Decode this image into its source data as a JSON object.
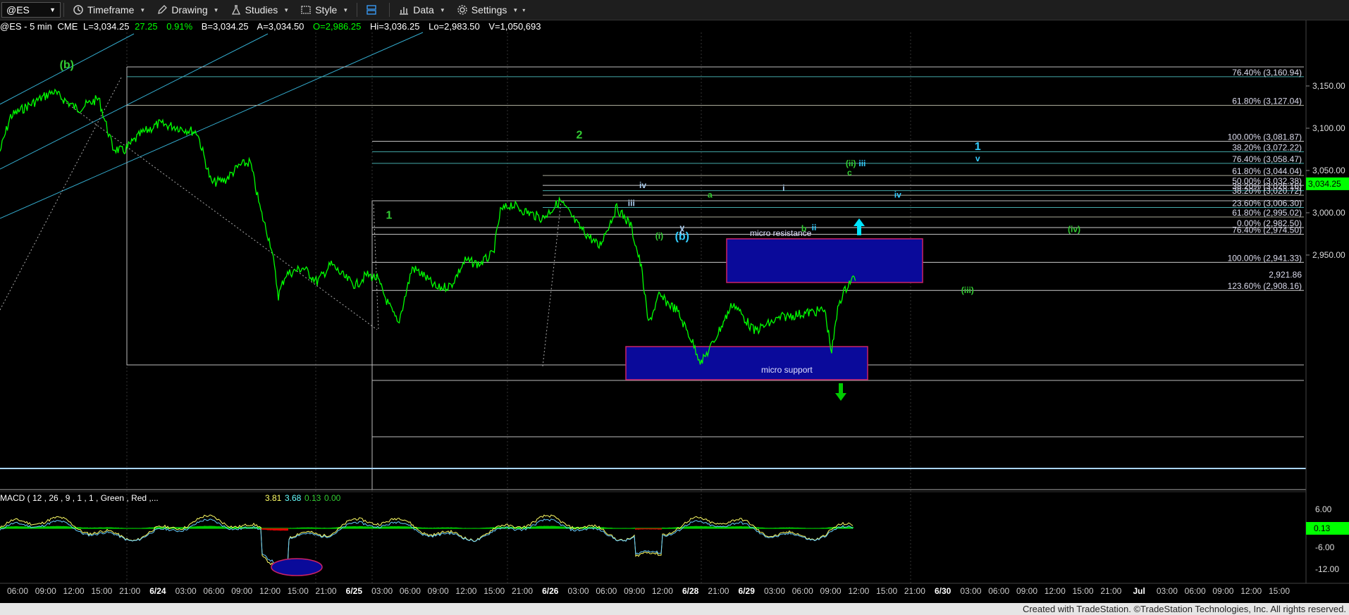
{
  "toolbar": {
    "symbol": "@ES",
    "timeframe": "Timeframe",
    "drawing": "Drawing",
    "studies": "Studies",
    "style": "Style",
    "data": "Data",
    "settings": "Settings"
  },
  "infobar": {
    "symbol": "@ES - 5 min",
    "exchange": "CME",
    "last": "L=3,034.25",
    "change": "27.25",
    "change_pct": "0.91%",
    "bid": "B=3,034.25",
    "ask": "A=3,034.50",
    "open": "O=2,986.25",
    "high": "Hi=3,036.25",
    "low": "Lo=2,983.50",
    "volume": "V=1,050,693",
    "change_color": "#00ff00"
  },
  "price_axis": {
    "ticks": [
      "3,150.00",
      "3,100.00",
      "3,050.00",
      "3,000.00",
      "2,950.00"
    ],
    "current": "3,034.25"
  },
  "fib_labels": [
    {
      "text": "76.40% (3,160.94)",
      "price": 3160.94
    },
    {
      "text": "61.80% (3,127.04)",
      "price": 3127.04
    },
    {
      "text": "100.00% (3,081.87)",
      "price": 3084.5
    },
    {
      "text": "38.20% (3,072.22)",
      "price": 3072.22
    },
    {
      "text": "76.40% (3,058.47)",
      "price": 3058.47
    },
    {
      "text": "61.80% (3,044.04)",
      "price": 3044.04
    },
    {
      "text": "50.00% (3,032.38)",
      "price": 3032.38
    },
    {
      "text": "38.20% (3,026.16)",
      "price": 3026.16
    },
    {
      "text": "38.20% (3,020.72)",
      "price": 3020.72
    },
    {
      "text": "23.60% (3,006.30)",
      "price": 3006.3
    },
    {
      "text": "61.80% (2,995.02)",
      "price": 2995.02
    },
    {
      "text": "0.00% (2,982.50)",
      "price": 2982.5
    },
    {
      "text": "76.40% (2,974.50)",
      "price": 2974.5
    },
    {
      "text": "100.00% (2,941.33)",
      "price": 2941.33
    },
    {
      "text": "2,921.86",
      "price": 2921.86
    },
    {
      "text": "123.60% (2,908.16)",
      "price": 2908.16
    }
  ],
  "zones": {
    "resistance": "micro resistance",
    "support": "micro support"
  },
  "wave_labels": [
    {
      "text": "(b)",
      "color": "#33cc33",
      "price": 3171,
      "t": 0.036
    },
    {
      "text": "2",
      "color": "#33cc33",
      "price": 3088,
      "t": 0.44
    },
    {
      "text": "1",
      "color": "#33cc33",
      "price": 2993,
      "t": 0.29
    },
    {
      "text": "(i)",
      "color": "#33cc33",
      "price": 2969,
      "t": 0.503
    },
    {
      "text": "(b)",
      "color": "#33ccff",
      "price": 2968,
      "t": 0.521
    },
    {
      "text": "v",
      "color": "#aaccee",
      "price": 2979,
      "t": 0.521
    },
    {
      "text": "c",
      "color": "#aaccee",
      "price": 2974,
      "t": 0.521
    },
    {
      "text": "iv",
      "color": "#aaccee",
      "price": 3029,
      "t": 0.49
    },
    {
      "text": "iii",
      "color": "#aaccee",
      "price": 3008,
      "t": 0.481
    },
    {
      "text": "a",
      "color": "#33cc33",
      "price": 3018,
      "t": 0.543
    },
    {
      "text": "i",
      "color": "#aaccee",
      "price": 3026,
      "t": 0.601
    },
    {
      "text": "b",
      "color": "#33cc33",
      "price": 2978,
      "t": 0.617
    },
    {
      "text": "ii",
      "color": "#33ccff",
      "price": 2979,
      "t": 0.625
    },
    {
      "text": "(ii)",
      "color": "#33cc33",
      "price": 3055,
      "t": 0.654
    },
    {
      "text": "iii",
      "color": "#33ccff",
      "price": 3055,
      "t": 0.663
    },
    {
      "text": "c",
      "color": "#33cc33",
      "price": 3044,
      "t": 0.653
    },
    {
      "text": "iv",
      "color": "#33ccff",
      "price": 3018,
      "t": 0.691
    },
    {
      "text": "1",
      "color": "#33ccff",
      "price": 3074,
      "t": 0.754
    },
    {
      "text": "v",
      "color": "#33ccff",
      "price": 3061,
      "t": 0.754
    },
    {
      "text": "(iv)",
      "color": "#33cc33",
      "price": 2977,
      "t": 0.83
    },
    {
      "text": "(iii)",
      "color": "#33cc33",
      "price": 2905,
      "t": 0.746
    }
  ],
  "macd": {
    "label": "MACD ( 12 , 26 , 9 , 1 , 1 , Green , Red ,...",
    "v1": "3.81",
    "v2": "3.68",
    "v3": "0.13",
    "v4": "0.00",
    "v1_color": "#ffff66",
    "v2_color": "#66ffff",
    "v3_color": "#33cc33",
    "v4_color": "#33cc33",
    "ticks": [
      "6.00",
      "0.13",
      "-6.00",
      "-12.00"
    ]
  },
  "time_axis": [
    "06:00",
    "09:00",
    "12:00",
    "15:00",
    "21:00",
    "6/24",
    "03:00",
    "06:00",
    "09:00",
    "12:00",
    "15:00",
    "21:00",
    "6/25",
    "03:00",
    "06:00",
    "09:00",
    "12:00",
    "15:00",
    "21:00",
    "6/26",
    "03:00",
    "06:00",
    "09:00",
    "12:00",
    "6/28",
    "21:00",
    "6/29",
    "03:00",
    "06:00",
    "09:00",
    "12:00",
    "15:00",
    "21:00",
    "6/30",
    "03:00",
    "06:00",
    "09:00",
    "12:00",
    "15:00",
    "21:00",
    "Jul",
    "03:00",
    "06:00",
    "09:00",
    "12:00",
    "15:00"
  ],
  "footer": "Created with TradeStation. ©TradeStation Technologies, Inc. All rights reserved.",
  "colors": {
    "price": "#00ff00",
    "zone_fill": "#0a0a9a",
    "zone_border": "#cc2266",
    "trend_cyan": "#33aacc",
    "arrow_up": "#00e5ff",
    "arrow_down": "#00cc00",
    "current_price_bg": "#00ff00"
  }
}
